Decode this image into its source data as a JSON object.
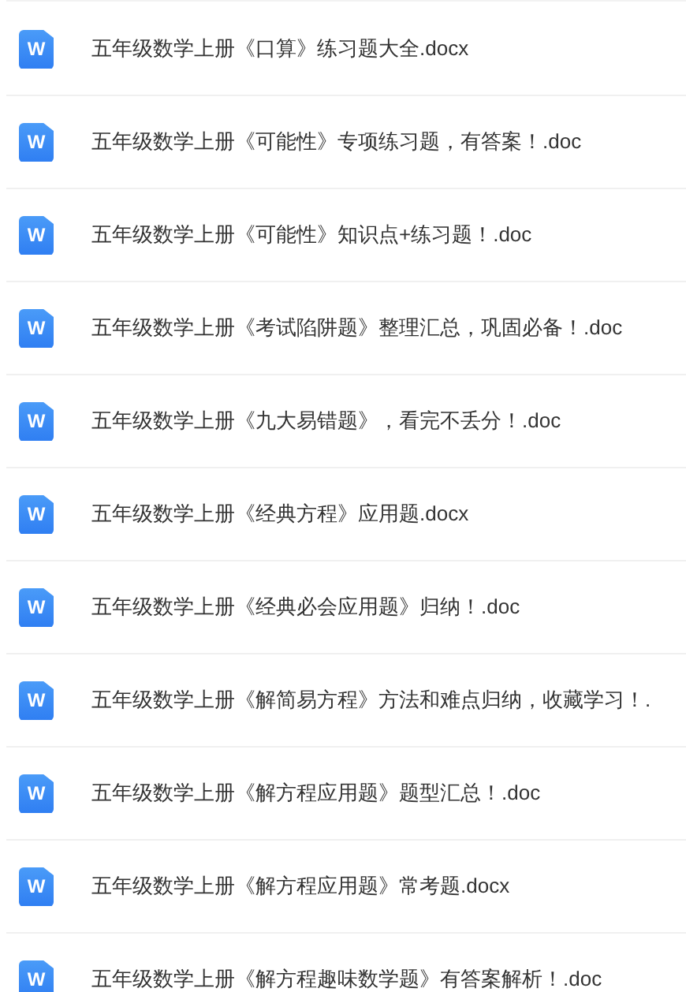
{
  "files": [
    {
      "name": "五年级数学上册《口算》练习题大全.docx",
      "icon": "W"
    },
    {
      "name": "五年级数学上册《可能性》专项练习题，有答案！.doc",
      "icon": "W"
    },
    {
      "name": "五年级数学上册《可能性》知识点+练习题！.doc",
      "icon": "W"
    },
    {
      "name": "五年级数学上册《考试陷阱题》整理汇总，巩固必备！.doc",
      "icon": "W"
    },
    {
      "name": "五年级数学上册《九大易错题》，看完不丢分！.doc",
      "icon": "W"
    },
    {
      "name": "五年级数学上册《经典方程》应用题.docx",
      "icon": "W"
    },
    {
      "name": "五年级数学上册《经典必会应用题》归纳！.doc",
      "icon": "W"
    },
    {
      "name": "五年级数学上册《解简易方程》方法和难点归纳，收藏学习！.",
      "icon": "W"
    },
    {
      "name": "五年级数学上册《解方程应用题》题型汇总！.doc",
      "icon": "W"
    },
    {
      "name": "五年级数学上册《解方程应用题》常考题.docx",
      "icon": "W"
    },
    {
      "name": "五年级数学上册《解方程趣味数学题》有答案解析！.doc",
      "icon": "W"
    }
  ]
}
